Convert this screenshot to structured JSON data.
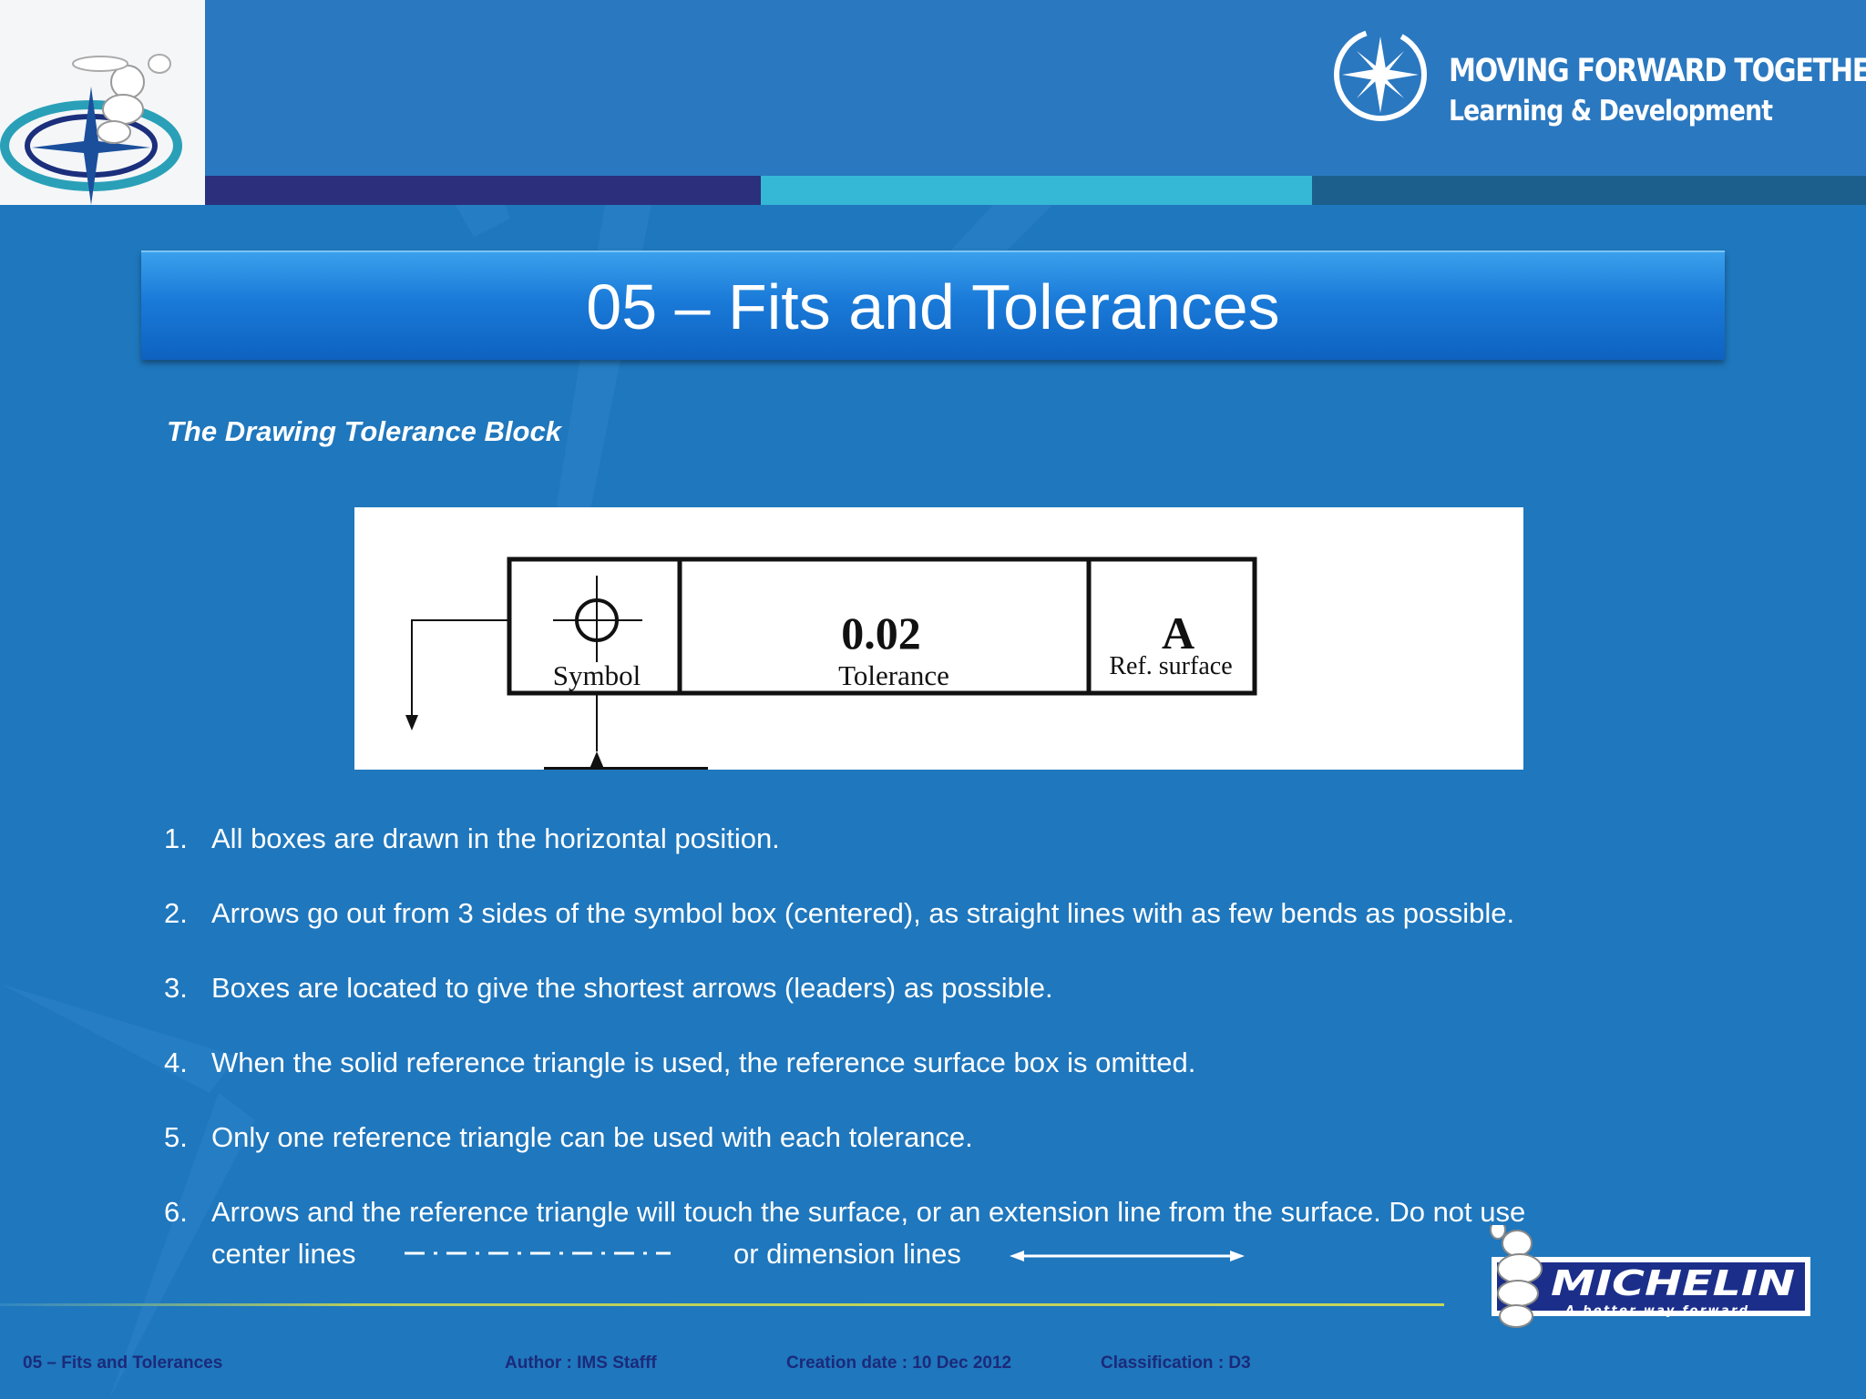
{
  "header": {
    "brand_line1": "MOVING FORWARD TOGETHER",
    "brand_line2": "Learning & Development"
  },
  "title": "05 – Fits and Tolerances",
  "subtitle": "The Drawing Tolerance Block",
  "diagram": {
    "tolerance_value": "0.02",
    "tolerance_label": "Tolerance",
    "symbol_label": "Symbol",
    "ref_letter": "A",
    "ref_label": "Ref. surface"
  },
  "rules": [
    {
      "num": "1.",
      "text": "All boxes are drawn in the horizontal position."
    },
    {
      "num": "2.",
      "text": "Arrows go out from 3 sides of the symbol box (centered), as straight lines  with as  few bends as possible."
    },
    {
      "num": "3.",
      "text": "Boxes are located to give the shortest arrows (leaders) as possible."
    },
    {
      "num": "4.",
      "text": "When the solid reference triangle is used, the reference surface box is omitted."
    },
    {
      "num": "5.",
      "text": "Only one reference triangle can be used with each tolerance."
    },
    {
      "num": "6.",
      "text": "Arrows and the reference triangle will touch the surface, or an extension line from the surface.  Do not use"
    }
  ],
  "rule6_continuation": {
    "part1": "center lines",
    "part2": "or dimension lines"
  },
  "footer": {
    "title": "05 – Fits and Tolerances",
    "author": "Author : IMS Stafff",
    "date": "Creation date : 10 Dec 2012",
    "classification": "Classification : D3"
  },
  "michelin": {
    "wordmark": "MICHELIN",
    "tagline": "A better way forward"
  },
  "colors": {
    "background": "#1f77bd",
    "title_bar": "#1a7ad8",
    "footer_text": "#1b2a7a"
  }
}
